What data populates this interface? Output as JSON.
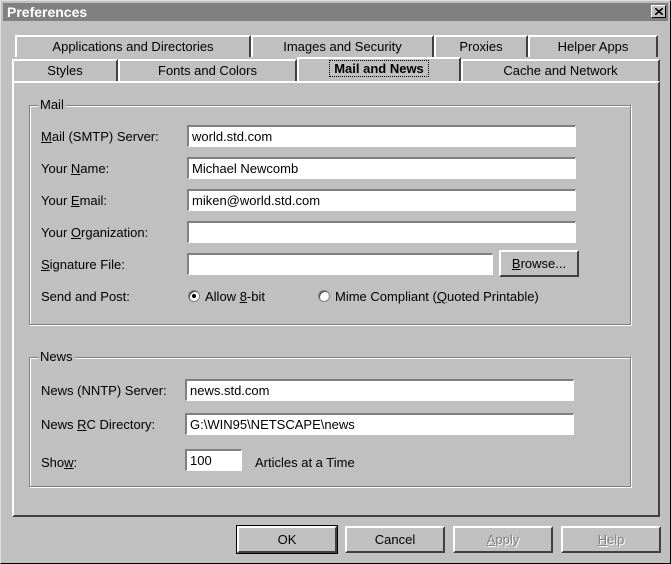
{
  "window": {
    "title": "Preferences"
  },
  "tabs": {
    "back_row": [
      "Applications and Directories",
      "Images and Security",
      "Proxies",
      "Helper Apps"
    ],
    "front_row": [
      "Styles",
      "Fonts and Colors",
      "Mail and News",
      "Cache and Network"
    ],
    "active": "Mail and News"
  },
  "mail": {
    "group_title": "Mail",
    "smtp_label_pre": "",
    "smtp_label_key": "M",
    "smtp_label_post": "ail (SMTP) Server:",
    "smtp_value": "world.std.com",
    "name_label_pre": "Your ",
    "name_label_key": "N",
    "name_label_post": "ame:",
    "name_value": "Michael Newcomb",
    "email_label_pre": "Your ",
    "email_label_key": "E",
    "email_label_post": "mail:",
    "email_value": "miken@world.std.com",
    "org_label_pre": "Your ",
    "org_label_key": "O",
    "org_label_post": "rganization:",
    "org_value": "",
    "sig_label_pre": "",
    "sig_label_key": "S",
    "sig_label_post": "ignature File:",
    "sig_value": "",
    "browse_pre": "",
    "browse_key": "B",
    "browse_post": "rowse...",
    "send_label": "Send and Post:",
    "opt1_pre": "Allow ",
    "opt1_key": "8",
    "opt1_post": "-bit",
    "opt2_pre": "Mime Compliant (",
    "opt2_key": "Q",
    "opt2_post": "uoted Printable)",
    "selected_option": "Allow 8-bit"
  },
  "news": {
    "group_title": "News",
    "server_label": "News (NNTP) Server:",
    "server_value": "news.std.com",
    "rc_label_pre": "News ",
    "rc_label_key": "R",
    "rc_label_post": "C Directory:",
    "rc_value": "G:\\WIN95\\NETSCAPE\\news",
    "show_label_pre": "Sho",
    "show_label_key": "w",
    "show_label_post": ":",
    "show_value": "100",
    "show_suffix": "Articles at a Time"
  },
  "buttons": {
    "ok": "OK",
    "cancel": "Cancel",
    "apply_key": "A",
    "apply_rest": "pply",
    "help_key": "H",
    "help_rest": "elp"
  }
}
